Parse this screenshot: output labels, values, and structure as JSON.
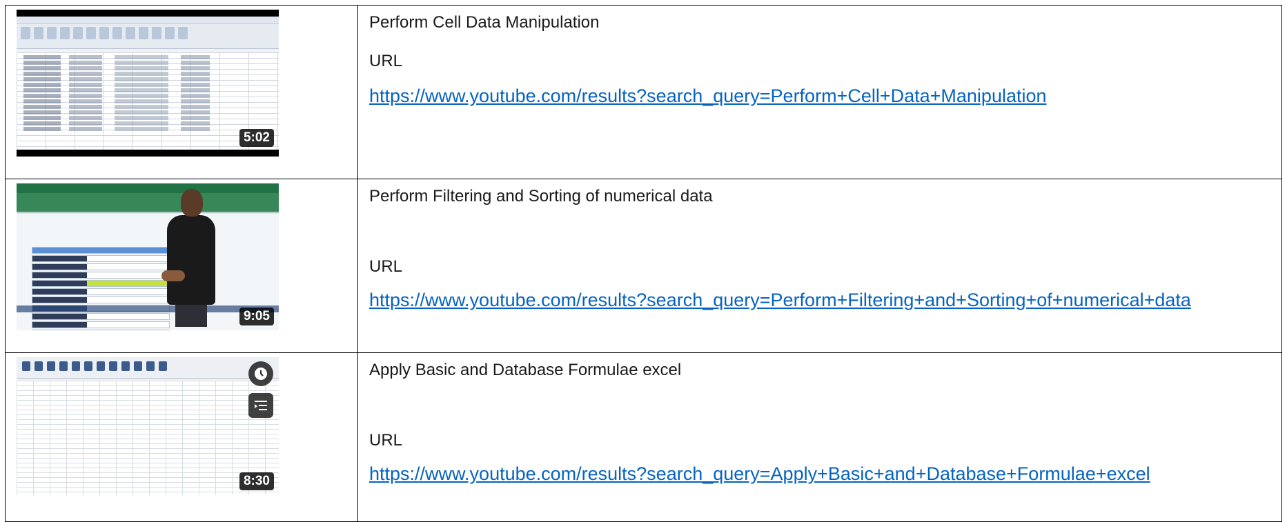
{
  "rows": [
    {
      "duration": "5:02",
      "title": "Perform Cell Data Manipulation",
      "url_label": "URL",
      "url": "https://www.youtube.com/results?search_query=Perform+Cell+Data+Manipulation"
    },
    {
      "duration": "9:05",
      "title": "Perform Filtering and Sorting of numerical data",
      "url_label": "URL",
      "url": "https://www.youtube.com/results?search_query=Perform+Filtering+and+Sorting+of+numerical+data"
    },
    {
      "duration": "8:30",
      "title": "Apply Basic and Database Formulae excel",
      "url_label": "URL",
      "url": "https://www.youtube.com/results?search_query=Apply+Basic+and+Database+Formulae+excel"
    }
  ],
  "icons": {
    "watch_later": "clock-icon",
    "add_to_queue": "queue-icon"
  },
  "colors": {
    "link": "#0563c1",
    "text": "#1a1a1a",
    "border": "#000000"
  }
}
